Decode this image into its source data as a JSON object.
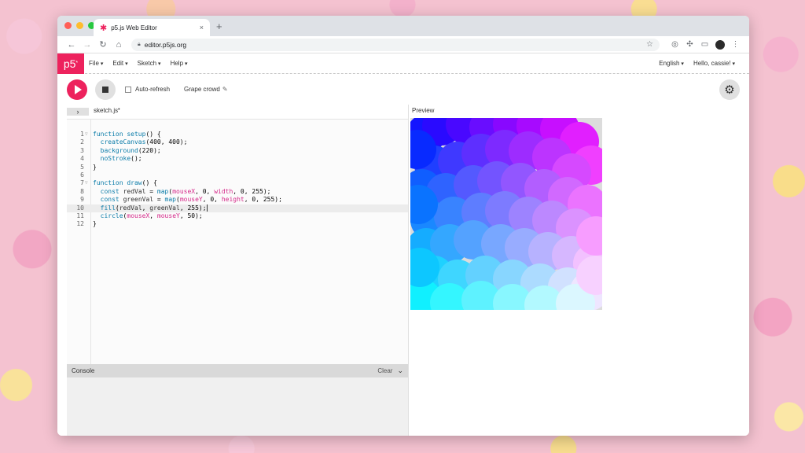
{
  "browser": {
    "tab_title": "p5.js Web Editor",
    "tab_close": "×",
    "new_tab": "+",
    "url": "editor.p5js.org"
  },
  "p5": {
    "logo": "p5",
    "logo_mark": "*",
    "menus": [
      "File",
      "Edit",
      "Sketch",
      "Help"
    ],
    "language": "English",
    "greeting": "Hello, cassie!"
  },
  "toolbar": {
    "auto_refresh_label": "Auto-refresh",
    "sketch_name": "Grape crowd"
  },
  "editor": {
    "file_name": "sketch.js",
    "modified_marker": "•",
    "active_line": 10,
    "lines": [
      "function setup() {",
      "  createCanvas(400, 400);",
      "  background(220);",
      "  noStroke();",
      "}",
      "",
      "function draw() {",
      "  const redVal = map(mouseX, 0, width, 0, 255);",
      "  const greenVal = map(mouseY, 0, height, 0, 255);",
      "  fill(redVal, greenVal, 255);",
      "  circle(mouseX, mouseY, 50);",
      "}"
    ]
  },
  "console": {
    "title": "Console",
    "clear_label": "Clear"
  },
  "preview": {
    "label": "Preview"
  },
  "colors": {
    "accent": "#ed225d",
    "canvas_bg": "#dcdcdc"
  }
}
